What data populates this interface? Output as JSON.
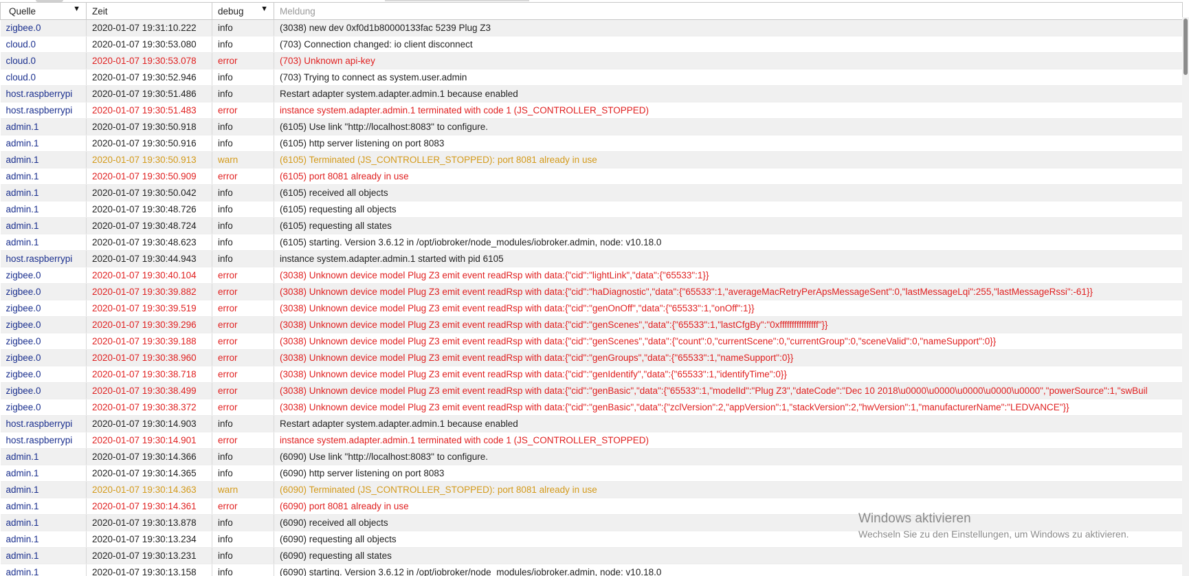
{
  "header": {
    "col_source": "Quelle",
    "col_time": "Zeit",
    "col_severity": "debug",
    "col_message_placeholder": "Meldung"
  },
  "colors": {
    "source": "#1a2f8e",
    "error": "#e02020",
    "warn": "#d49a1a",
    "info": "#222222"
  },
  "rows": [
    {
      "source": "zigbee.0",
      "time": "2020-01-07 19:31:10.222",
      "severity": "info",
      "message": "(3038) new dev 0xf0d1b80000133fac 5239 Plug Z3"
    },
    {
      "source": "cloud.0",
      "time": "2020-01-07 19:30:53.080",
      "severity": "info",
      "message": "(703) Connection changed: io client disconnect"
    },
    {
      "source": "cloud.0",
      "time": "2020-01-07 19:30:53.078",
      "severity": "error",
      "message": "(703) Unknown api-key"
    },
    {
      "source": "cloud.0",
      "time": "2020-01-07 19:30:52.946",
      "severity": "info",
      "message": "(703) Trying to connect as system.user.admin"
    },
    {
      "source": "host.raspberrypi",
      "time": "2020-01-07 19:30:51.486",
      "severity": "info",
      "message": "Restart adapter system.adapter.admin.1 because enabled"
    },
    {
      "source": "host.raspberrypi",
      "time": "2020-01-07 19:30:51.483",
      "severity": "error",
      "message": "instance system.adapter.admin.1 terminated with code 1 (JS_CONTROLLER_STOPPED)"
    },
    {
      "source": "admin.1",
      "time": "2020-01-07 19:30:50.918",
      "severity": "info",
      "message": "(6105) Use link \"http://localhost:8083\" to configure."
    },
    {
      "source": "admin.1",
      "time": "2020-01-07 19:30:50.916",
      "severity": "info",
      "message": "(6105) http server listening on port 8083"
    },
    {
      "source": "admin.1",
      "time": "2020-01-07 19:30:50.913",
      "severity": "warn",
      "message": "(6105) Terminated (JS_CONTROLLER_STOPPED): port 8081 already in use"
    },
    {
      "source": "admin.1",
      "time": "2020-01-07 19:30:50.909",
      "severity": "error",
      "message": "(6105) port 8081 already in use"
    },
    {
      "source": "admin.1",
      "time": "2020-01-07 19:30:50.042",
      "severity": "info",
      "message": "(6105) received all objects"
    },
    {
      "source": "admin.1",
      "time": "2020-01-07 19:30:48.726",
      "severity": "info",
      "message": "(6105) requesting all objects"
    },
    {
      "source": "admin.1",
      "time": "2020-01-07 19:30:48.724",
      "severity": "info",
      "message": "(6105) requesting all states"
    },
    {
      "source": "admin.1",
      "time": "2020-01-07 19:30:48.623",
      "severity": "info",
      "message": "(6105) starting. Version 3.6.12 in /opt/iobroker/node_modules/iobroker.admin, node: v10.18.0"
    },
    {
      "source": "host.raspberrypi",
      "time": "2020-01-07 19:30:44.943",
      "severity": "info",
      "message": "instance system.adapter.admin.1 started with pid 6105"
    },
    {
      "source": "zigbee.0",
      "time": "2020-01-07 19:30:40.104",
      "severity": "error",
      "message": "(3038) Unknown device model Plug Z3 emit event readRsp with data:{\"cid\":\"lightLink\",\"data\":{\"65533\":1}}"
    },
    {
      "source": "zigbee.0",
      "time": "2020-01-07 19:30:39.882",
      "severity": "error",
      "message": "(3038) Unknown device model Plug Z3 emit event readRsp with data:{\"cid\":\"haDiagnostic\",\"data\":{\"65533\":1,\"averageMacRetryPerApsMessageSent\":0,\"lastMessageLqi\":255,\"lastMessageRssi\":-61}}"
    },
    {
      "source": "zigbee.0",
      "time": "2020-01-07 19:30:39.519",
      "severity": "error",
      "message": "(3038) Unknown device model Plug Z3 emit event readRsp with data:{\"cid\":\"genOnOff\",\"data\":{\"65533\":1,\"onOff\":1}}"
    },
    {
      "source": "zigbee.0",
      "time": "2020-01-07 19:30:39.296",
      "severity": "error",
      "message": "(3038) Unknown device model Plug Z3 emit event readRsp with data:{\"cid\":\"genScenes\",\"data\":{\"65533\":1,\"lastCfgBy\":\"0xffffffffffffffff\"}}"
    },
    {
      "source": "zigbee.0",
      "time": "2020-01-07 19:30:39.188",
      "severity": "error",
      "message": "(3038) Unknown device model Plug Z3 emit event readRsp with data:{\"cid\":\"genScenes\",\"data\":{\"count\":0,\"currentScene\":0,\"currentGroup\":0,\"sceneValid\":0,\"nameSupport\":0}}"
    },
    {
      "source": "zigbee.0",
      "time": "2020-01-07 19:30:38.960",
      "severity": "error",
      "message": "(3038) Unknown device model Plug Z3 emit event readRsp with data:{\"cid\":\"genGroups\",\"data\":{\"65533\":1,\"nameSupport\":0}}"
    },
    {
      "source": "zigbee.0",
      "time": "2020-01-07 19:30:38.718",
      "severity": "error",
      "message": "(3038) Unknown device model Plug Z3 emit event readRsp with data:{\"cid\":\"genIdentify\",\"data\":{\"65533\":1,\"identifyTime\":0}}"
    },
    {
      "source": "zigbee.0",
      "time": "2020-01-07 19:30:38.499",
      "severity": "error",
      "message": "(3038) Unknown device model Plug Z3 emit event readRsp with data:{\"cid\":\"genBasic\",\"data\":{\"65533\":1,\"modelId\":\"Plug Z3\",\"dateCode\":\"Dec 10 2018\\u0000\\u0000\\u0000\\u0000\\u0000\",\"powerSource\":1,\"swBuil"
    },
    {
      "source": "zigbee.0",
      "time": "2020-01-07 19:30:38.372",
      "severity": "error",
      "message": "(3038) Unknown device model Plug Z3 emit event readRsp with data:{\"cid\":\"genBasic\",\"data\":{\"zclVersion\":2,\"appVersion\":1,\"stackVersion\":2,\"hwVersion\":1,\"manufacturerName\":\"LEDVANCE\"}}"
    },
    {
      "source": "host.raspberrypi",
      "time": "2020-01-07 19:30:14.903",
      "severity": "info",
      "message": "Restart adapter system.adapter.admin.1 because enabled"
    },
    {
      "source": "host.raspberrypi",
      "time": "2020-01-07 19:30:14.901",
      "severity": "error",
      "message": "instance system.adapter.admin.1 terminated with code 1 (JS_CONTROLLER_STOPPED)"
    },
    {
      "source": "admin.1",
      "time": "2020-01-07 19:30:14.366",
      "severity": "info",
      "message": "(6090) Use link \"http://localhost:8083\" to configure."
    },
    {
      "source": "admin.1",
      "time": "2020-01-07 19:30:14.365",
      "severity": "info",
      "message": "(6090) http server listening on port 8083"
    },
    {
      "source": "admin.1",
      "time": "2020-01-07 19:30:14.363",
      "severity": "warn",
      "message": "(6090) Terminated (JS_CONTROLLER_STOPPED): port 8081 already in use"
    },
    {
      "source": "admin.1",
      "time": "2020-01-07 19:30:14.361",
      "severity": "error",
      "message": "(6090) port 8081 already in use"
    },
    {
      "source": "admin.1",
      "time": "2020-01-07 19:30:13.878",
      "severity": "info",
      "message": "(6090) received all objects"
    },
    {
      "source": "admin.1",
      "time": "2020-01-07 19:30:13.234",
      "severity": "info",
      "message": "(6090) requesting all objects"
    },
    {
      "source": "admin.1",
      "time": "2020-01-07 19:30:13.231",
      "severity": "info",
      "message": "(6090) requesting all states"
    },
    {
      "source": "admin.1",
      "time": "2020-01-07 19:30:13.158",
      "severity": "info",
      "message": "(6090) starting. Version 3.6.12 in /opt/iobroker/node_modules/iobroker.admin, node: v10.18.0"
    }
  ],
  "watermark": {
    "title": "Windows aktivieren",
    "subtitle": "Wechseln Sie zu den Einstellungen, um Windows zu aktivieren."
  }
}
